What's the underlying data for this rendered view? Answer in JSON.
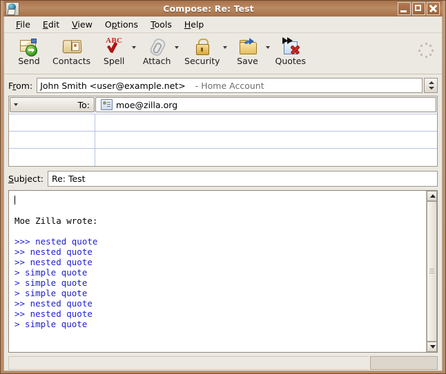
{
  "window": {
    "title": "Compose: Re: Test",
    "icon": "compose-mail-icon",
    "controls": {
      "minimize": "minimize-button",
      "maximize": "maximize-button",
      "close": "close-button"
    }
  },
  "menubar": {
    "items": [
      {
        "label": "File",
        "accel": "F"
      },
      {
        "label": "Edit",
        "accel": "E"
      },
      {
        "label": "View",
        "accel": "V"
      },
      {
        "label": "Options",
        "accel": "p"
      },
      {
        "label": "Tools",
        "accel": "T"
      },
      {
        "label": "Help",
        "accel": "H"
      }
    ]
  },
  "toolbar": {
    "buttons": [
      {
        "label": "Send",
        "icon": "send-icon",
        "dropdown": false
      },
      {
        "label": "Contacts",
        "icon": "contacts-icon",
        "dropdown": false
      },
      {
        "label": "Spell",
        "icon": "spell-check-icon",
        "dropdown": true
      },
      {
        "label": "Attach",
        "icon": "paperclip-icon",
        "dropdown": true
      },
      {
        "label": "Security",
        "icon": "lock-icon",
        "dropdown": true
      },
      {
        "label": "Save",
        "icon": "save-folder-icon",
        "dropdown": true
      },
      {
        "label": "Quotes",
        "icon": "quotes-remove-icon",
        "dropdown": false
      }
    ],
    "throbber": "throbber-icon"
  },
  "headers": {
    "from": {
      "label": "From:",
      "accel": "r",
      "value": "John Smith <user@example.net>",
      "account": "- Home Account"
    },
    "recipients": {
      "rows": [
        {
          "type": "To:",
          "value": "moe@zilla.org",
          "icon": "contact-card-icon"
        },
        {
          "type": "",
          "value": ""
        },
        {
          "type": "",
          "value": ""
        },
        {
          "type": "",
          "value": ""
        }
      ]
    },
    "subject": {
      "label": "Subject:",
      "accel": "S",
      "value": "Re: Test",
      "placeholder": ""
    }
  },
  "body": {
    "lines": [
      {
        "text": "",
        "quote": false,
        "caret": true
      },
      {
        "text": "",
        "quote": false
      },
      {
        "text": "Moe Zilla wrote:",
        "quote": false
      },
      {
        "text": "",
        "quote": false
      },
      {
        "text": ">>> nested quote",
        "quote": true
      },
      {
        "text": ">> nested quote",
        "quote": true
      },
      {
        "text": ">> nested quote",
        "quote": true
      },
      {
        "text": "> simple quote",
        "quote": true
      },
      {
        "text": "> simple quote",
        "quote": true
      },
      {
        "text": "> simple quote",
        "quote": true
      },
      {
        "text": ">> nested quote",
        "quote": true
      },
      {
        "text": ">> nested quote",
        "quote": true
      },
      {
        "text": "> simple quote",
        "quote": true
      }
    ],
    "quote_color": "#2020d0",
    "scrollbar": {
      "up": "scroll-up-icon",
      "down": "scroll-down-icon"
    }
  },
  "statusbar": {
    "message": "",
    "progress": ""
  },
  "colors": {
    "titlebar": "#b07b53",
    "chrome": "#ece9e2",
    "field_border": "#9c958a",
    "quote_text": "#2020d0"
  }
}
